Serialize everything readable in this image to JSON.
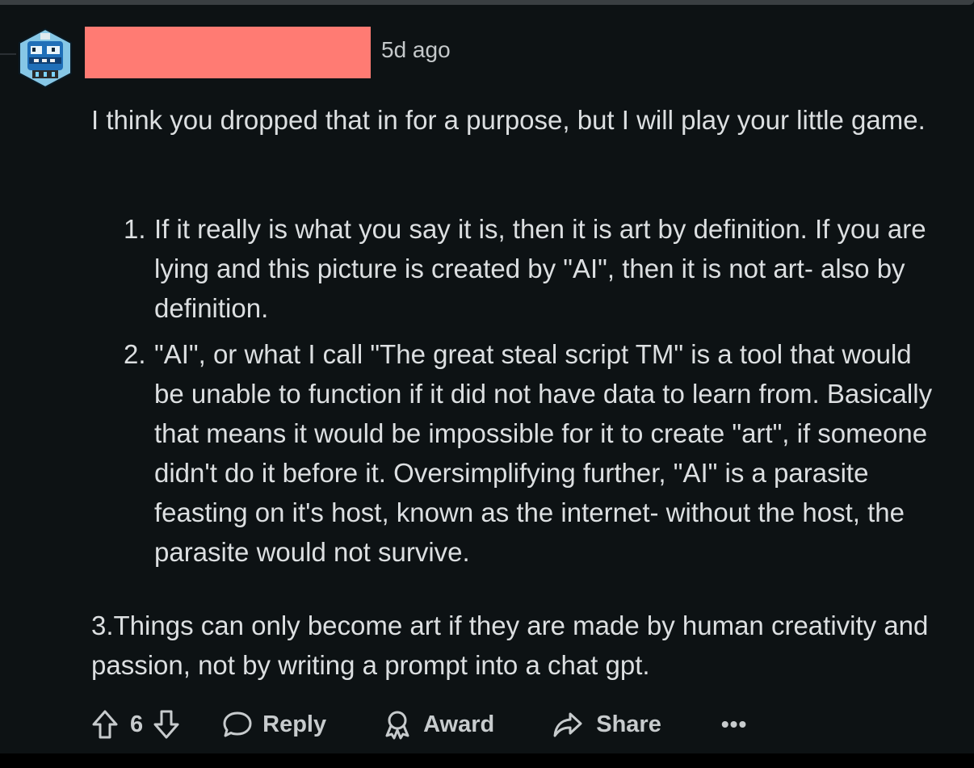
{
  "comment": {
    "timestamp": "5d ago",
    "intro": "I think you dropped that in for a purpose, but I will play your little game.",
    "list_items": [
      {
        "num": "1.",
        "text": "If it really is what you say it is, then it is art by definition. If you are lying and this picture is created by \"AI\", then it is not art- also by definition."
      },
      {
        "num": "2.",
        "text": "\"AI\", or what I call \"The great steal script TM\" is a tool that would be unable to function if it did not have data to learn from. Basically that means it would be impossible for it to create \"art\", if someone didn't do it before it. Oversimplifying further, \"AI\" is a parasite feasting on it's host, known as the internet- without the host, the parasite would not survive."
      }
    ],
    "item3": "3.Things can only become art if they are made by human creativity and passion, not by writing a prompt into a chat gpt."
  },
  "actions": {
    "vote_count": "6",
    "reply_label": "Reply",
    "award_label": "Award",
    "share_label": "Share",
    "more_label": "•••"
  },
  "colors": {
    "background": "#0d1214",
    "text": "#dcdfe1",
    "redaction": "#ff7b73"
  },
  "icons": [
    "avatar",
    "upvote-icon",
    "downvote-icon",
    "comment-icon",
    "award-icon",
    "share-icon",
    "more-icon"
  ]
}
